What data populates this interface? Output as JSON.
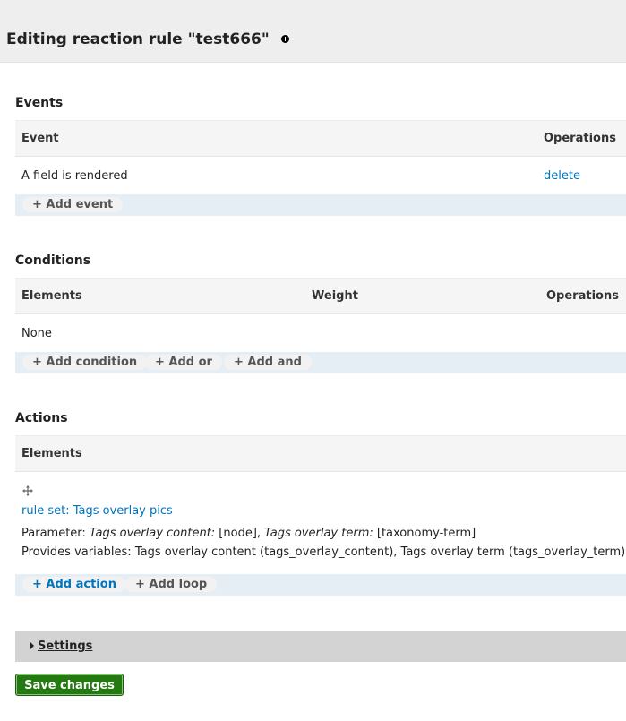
{
  "header": {
    "title": "Editing reaction rule \"test666\"",
    "add_icon": "plus-circle-icon"
  },
  "events": {
    "title": "Events",
    "columns": [
      "Event",
      "Operations"
    ],
    "rows": [
      {
        "event": "A field is rendered",
        "operation": "delete"
      }
    ],
    "buttons": {
      "add_event": "+ Add event"
    }
  },
  "conditions": {
    "title": "Conditions",
    "columns": [
      "Elements",
      "Weight",
      "Operations"
    ],
    "empty_text": "None",
    "buttons": {
      "add_condition": "+ Add condition",
      "add_or": "+ Add or",
      "add_and": "+ Add and"
    }
  },
  "actions": {
    "title": "Actions",
    "columns": [
      "Elements"
    ],
    "item": {
      "handle_icon": "move-handle-icon",
      "link": "rule set: Tags overlay pics",
      "parameter_label": "Parameter: ",
      "param1_name": "Tags overlay content:",
      "param1_value": " [node], ",
      "param2_name": "Tags overlay term:",
      "param2_value": " [taxonomy-term]",
      "provides": "Provides variables: Tags overlay content (tags_overlay_content), Tags overlay term (tags_overlay_term)"
    },
    "buttons": {
      "add_action": "+ Add action",
      "add_loop": "+ Add loop"
    }
  },
  "settings": {
    "label": "Settings",
    "icon": "triangle-right-icon"
  },
  "save_button": "Save changes",
  "colors": {
    "link": "#0074bd",
    "save_button": "#237a10",
    "header_bg": "#eeeeee",
    "button_bar": "#e6eef5"
  }
}
